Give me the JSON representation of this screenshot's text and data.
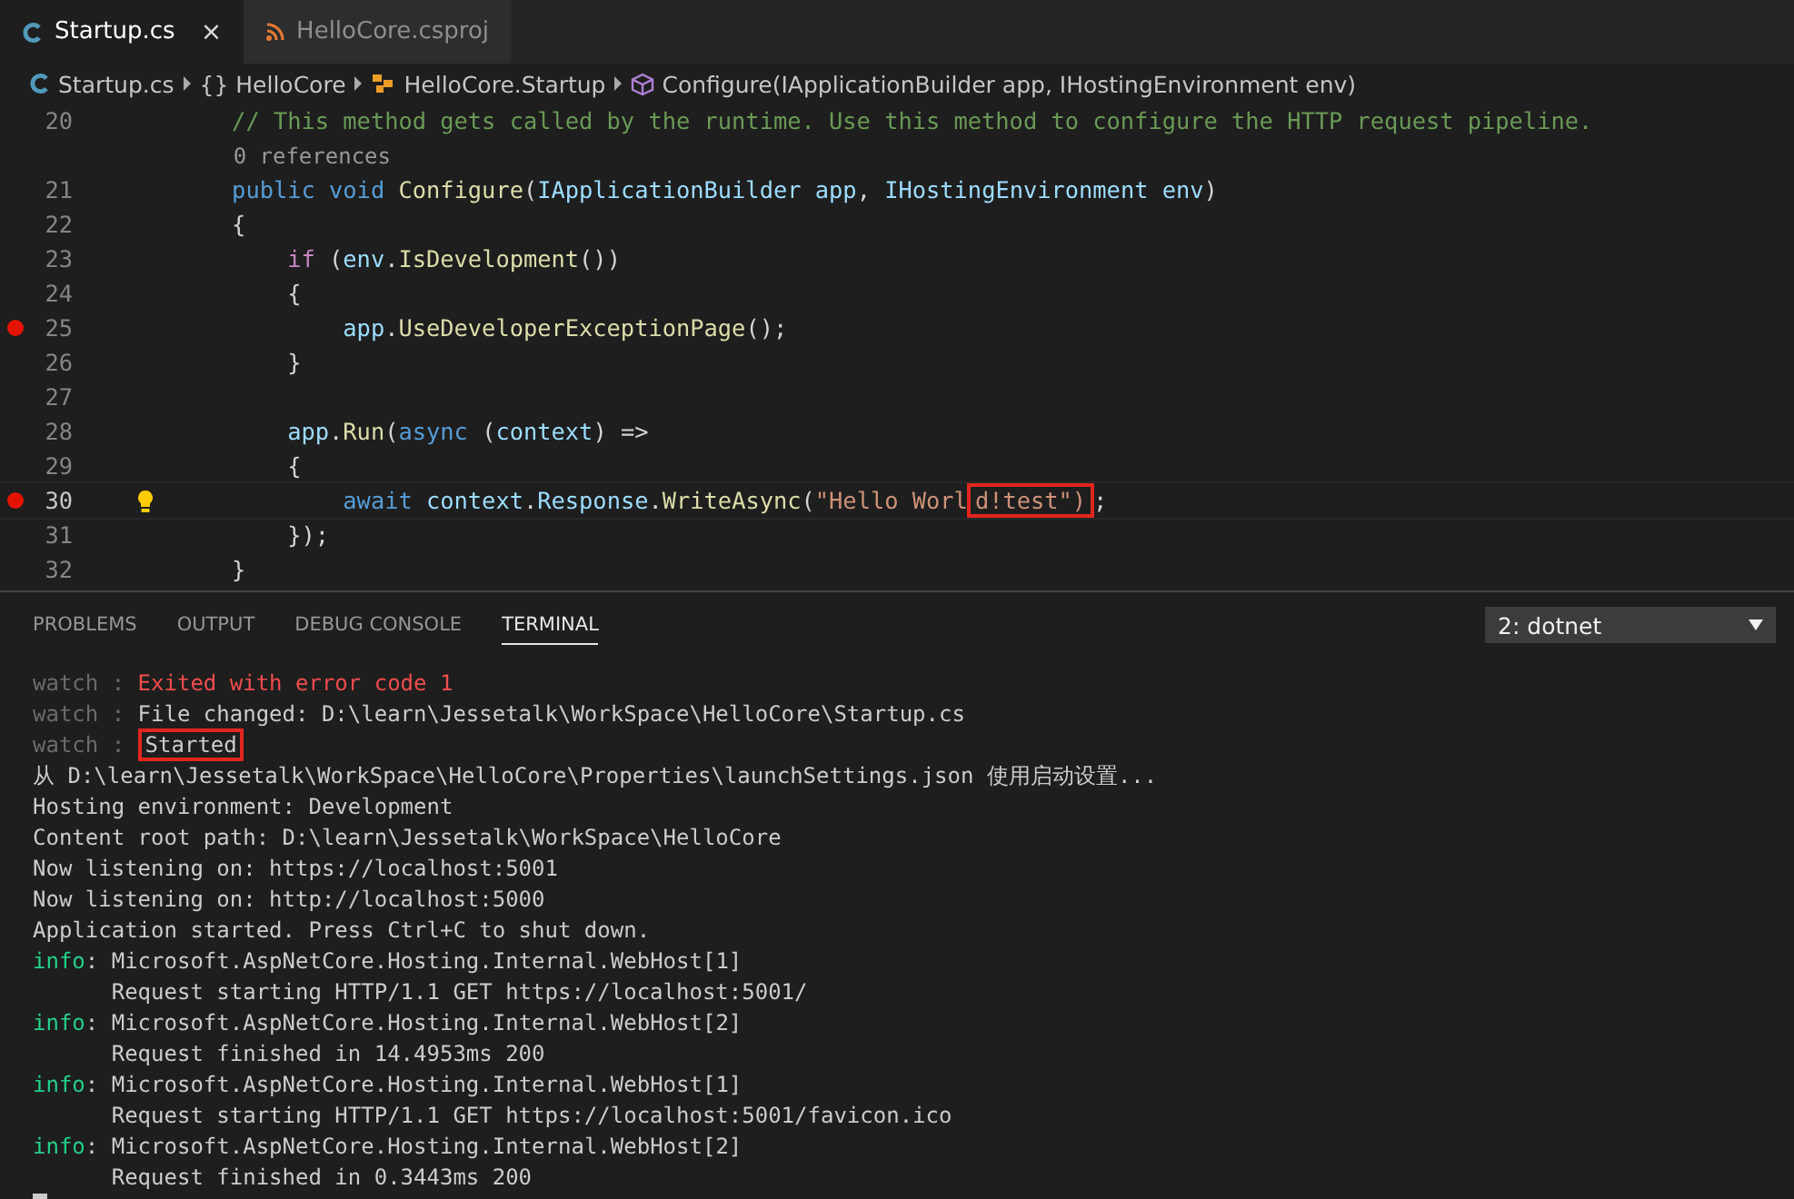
{
  "editor_tabs": [
    {
      "label": "Startup.cs",
      "kind": "csharp",
      "selected": true,
      "close": "×"
    },
    {
      "label": "HelloCore.csproj",
      "kind": "rss",
      "selected": false
    }
  ],
  "breadcrumb": [
    {
      "label": "Startup.cs",
      "kind": "csharp"
    },
    {
      "label": "{} HelloCore",
      "kind": "plain"
    },
    {
      "label": "HelloCore.Startup",
      "kind": "class"
    },
    {
      "label": "Configure(IApplicationBuilder app, IHostingEnvironment env)",
      "kind": "method"
    }
  ],
  "code_lines": [
    {
      "number": "20",
      "breakpoint": false,
      "lightbulb": false,
      "tokens": [
        {
          "text": "    // This method gets called by the runtime. Use this method to configure the HTTP request pipeline.",
          "kind": "comment"
        }
      ]
    },
    {
      "number": "21",
      "breakpoint": false,
      "lightbulb": false,
      "codelens": "0 references",
      "tokens": [
        {
          "text": "    public void ",
          "kind": "keyword"
        },
        {
          "text": "Configure",
          "kind": "method"
        },
        {
          "text": "(",
          "kind": "plain"
        },
        {
          "text": "IApplicationBuilder ",
          "kind": "type"
        },
        {
          "text": "app",
          "kind": "variable"
        },
        {
          "text": ", ",
          "kind": "plain"
        },
        {
          "text": "IHostingEnvironment ",
          "kind": "type"
        },
        {
          "text": "env",
          "kind": "variable"
        },
        {
          "text": ")",
          "kind": "plain"
        }
      ]
    },
    {
      "number": "22",
      "breakpoint": false,
      "lightbulb": false,
      "tokens": [
        {
          "text": "    {",
          "kind": "plain"
        }
      ]
    },
    {
      "number": "23",
      "breakpoint": false,
      "lightbulb": false,
      "tokens": [
        {
          "text": "        if ",
          "kind": "control"
        },
        {
          "text": "(",
          "kind": "plain"
        },
        {
          "text": "env",
          "kind": "variable"
        },
        {
          "text": ".",
          "kind": "plain"
        },
        {
          "text": "IsDevelopment",
          "kind": "method"
        },
        {
          "text": "())",
          "kind": "plain"
        }
      ]
    },
    {
      "number": "24",
      "breakpoint": false,
      "lightbulb": false,
      "tokens": [
        {
          "text": "        {",
          "kind": "plain"
        }
      ]
    },
    {
      "number": "25",
      "breakpoint": true,
      "lightbulb": false,
      "tokens": [
        {
          "text": "            app",
          "kind": "variable"
        },
        {
          "text": ".",
          "kind": "plain"
        },
        {
          "text": "UseDeveloperExceptionPage",
          "kind": "method"
        },
        {
          "text": "();",
          "kind": "plain"
        }
      ]
    },
    {
      "number": "26",
      "breakpoint": false,
      "lightbulb": false,
      "tokens": [
        {
          "text": "        }",
          "kind": "plain"
        }
      ]
    },
    {
      "number": "27",
      "breakpoint": false,
      "lightbulb": false
    },
    {
      "number": "28",
      "breakpoint": false,
      "lightbulb": false,
      "tokens": [
        {
          "text": "        app",
          "kind": "variable"
        },
        {
          "text": ".",
          "kind": "plain"
        },
        {
          "text": "Run",
          "kind": "method"
        },
        {
          "text": "(",
          "kind": "plain"
        },
        {
          "text": "async ",
          "kind": "keyword"
        },
        {
          "text": "(",
          "kind": "plain"
        },
        {
          "text": "context",
          "kind": "variable"
        },
        {
          "text": ") =>",
          "kind": "plain"
        }
      ]
    },
    {
      "number": "29",
      "breakpoint": false,
      "lightbulb": false,
      "tokens": [
        {
          "text": "        {",
          "kind": "plain"
        }
      ]
    },
    {
      "number": "30",
      "breakpoint": true,
      "lightbulb": true,
      "current": true,
      "tokens": [
        {
          "text": "            await ",
          "kind": "keyword"
        },
        {
          "text": "context",
          "kind": "variable"
        },
        {
          "text": ".",
          "kind": "plain"
        },
        {
          "text": "Response",
          "kind": "variable"
        },
        {
          "text": ".",
          "kind": "plain"
        },
        {
          "text": "WriteAsync",
          "kind": "method"
        },
        {
          "text": "(",
          "kind": "plain"
        },
        {
          "text": "\"Hello Worl",
          "kind": "string"
        },
        {
          "text": "d!test\")",
          "kind": "string",
          "highlighted": true
        },
        {
          "text": ";",
          "kind": "plain"
        }
      ]
    },
    {
      "number": "31",
      "breakpoint": false,
      "lightbulb": false,
      "tokens": [
        {
          "text": "        });",
          "kind": "plain"
        }
      ]
    },
    {
      "number": "32",
      "breakpoint": false,
      "lightbulb": false,
      "tokens": [
        {
          "text": "    }",
          "kind": "plain"
        }
      ]
    }
  ],
  "panel_tabs": [
    {
      "label": "PROBLEMS",
      "selected": false
    },
    {
      "label": "OUTPUT",
      "selected": false
    },
    {
      "label": "DEBUG CONSOLE",
      "selected": false
    },
    {
      "label": "TERMINAL",
      "selected": true
    }
  ],
  "terminal_select": {
    "value": "2: dotnet"
  },
  "terminal_lines": [
    {
      "segments": [
        {
          "text": "watch : ",
          "kind": "dim"
        },
        {
          "text": "Exited with error code 1",
          "kind": "error"
        }
      ]
    },
    {
      "segments": [
        {
          "text": "watch : ",
          "kind": "dim"
        },
        {
          "text": "File changed: D:\\learn\\Jessetalk\\WorkSpace\\HelloCore\\Startup.cs",
          "kind": "plain"
        }
      ]
    },
    {
      "segments": [
        {
          "text": "watch : ",
          "kind": "dim"
        },
        {
          "text": "Started",
          "kind": "plain",
          "highlighted": true
        }
      ]
    },
    {
      "segments": [
        {
          "text": "从 D:\\learn\\Jessetalk\\WorkSpace\\HelloCore\\Properties\\launchSettings.json 使用启动设置...",
          "kind": "plain"
        }
      ]
    },
    {
      "segments": [
        {
          "text": "Hosting environment: Development",
          "kind": "plain"
        }
      ]
    },
    {
      "segments": [
        {
          "text": "Content root path: D:\\learn\\Jessetalk\\WorkSpace\\HelloCore",
          "kind": "plain"
        }
      ]
    },
    {
      "segments": [
        {
          "text": "Now listening on: https://localhost:5001",
          "kind": "plain"
        }
      ]
    },
    {
      "segments": [
        {
          "text": "Now listening on: http://localhost:5000",
          "kind": "plain"
        }
      ]
    },
    {
      "segments": [
        {
          "text": "Application started. Press Ctrl+C to shut down.",
          "kind": "plain"
        }
      ]
    },
    {
      "segments": [
        {
          "text": "info",
          "kind": "info"
        },
        {
          "text": ": Microsoft.AspNetCore.Hosting.Internal.WebHost[1]",
          "kind": "plain"
        }
      ]
    },
    {
      "segments": [
        {
          "text": "      Request starting HTTP/1.1 GET https://localhost:5001/",
          "kind": "plain"
        }
      ]
    },
    {
      "segments": [
        {
          "text": "info",
          "kind": "info"
        },
        {
          "text": ": Microsoft.AspNetCore.Hosting.Internal.WebHost[2]",
          "kind": "plain"
        }
      ]
    },
    {
      "segments": [
        {
          "text": "      Request finished in 14.4953ms 200",
          "kind": "plain"
        }
      ]
    },
    {
      "segments": [
        {
          "text": "info",
          "kind": "info"
        },
        {
          "text": ": Microsoft.AspNetCore.Hosting.Internal.WebHost[1]",
          "kind": "plain"
        }
      ]
    },
    {
      "segments": [
        {
          "text": "      Request starting HTTP/1.1 GET https://localhost:5001/favicon.ico",
          "kind": "plain"
        }
      ]
    },
    {
      "segments": [
        {
          "text": "info",
          "kind": "info"
        },
        {
          "text": ": Microsoft.AspNetCore.Hosting.Internal.WebHost[2]",
          "kind": "plain"
        }
      ]
    },
    {
      "segments": [
        {
          "text": "      Request finished in 0.3443ms 200",
          "kind": "plain"
        }
      ]
    }
  ]
}
